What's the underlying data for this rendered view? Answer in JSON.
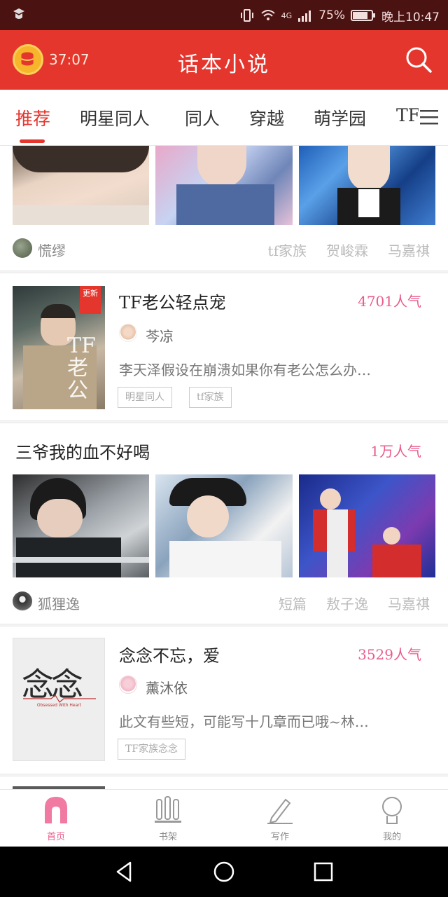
{
  "status_bar": {
    "network": "4G",
    "battery": "75%",
    "time": "晚上10:47"
  },
  "app_bar": {
    "timer": "37:07",
    "title": "话本小说"
  },
  "tabs": [
    "推荐",
    "明星同人",
    "同人",
    "穿越",
    "萌学园",
    "TF"
  ],
  "active_tab": 0,
  "feed": {
    "first_card": {
      "author": "慌缪",
      "tags": [
        "tf家族",
        "贺峻霖",
        "马嘉祺"
      ]
    },
    "book1": {
      "badge": "更新",
      "cover_text": "TF 老公",
      "title": "TF老公轻点宠",
      "popularity": "4701人气",
      "author": "芩凉",
      "description": "李天泽假设在崩溃如果你有老公怎么办…",
      "chips": [
        "明星同人",
        "tf家族"
      ]
    },
    "card2": {
      "title": "三爷我的血不好喝",
      "popularity": "1万人气",
      "author": "狐狸逸",
      "tags": [
        "短篇",
        "敖子逸",
        "马嘉祺"
      ]
    },
    "book2": {
      "cover_title": "念念",
      "cover_subtitle": "Obsessed With Heart",
      "title": "念念不忘，爱",
      "popularity": "3529人气",
      "author": "薰沐依",
      "description": "此文有些短，可能写十几章而已哦~林…",
      "chips": [
        "TF家族念念"
      ]
    }
  },
  "bottom_nav": [
    {
      "label": "首页",
      "icon": "home-icon"
    },
    {
      "label": "书架",
      "icon": "bookshelf-icon"
    },
    {
      "label": "写作",
      "icon": "pencil-icon"
    },
    {
      "label": "我的",
      "icon": "profile-icon"
    }
  ],
  "colors": {
    "brand_red": "#e5362d",
    "status_bar": "#4a1210",
    "popularity_pink": "#ea5b8a"
  }
}
